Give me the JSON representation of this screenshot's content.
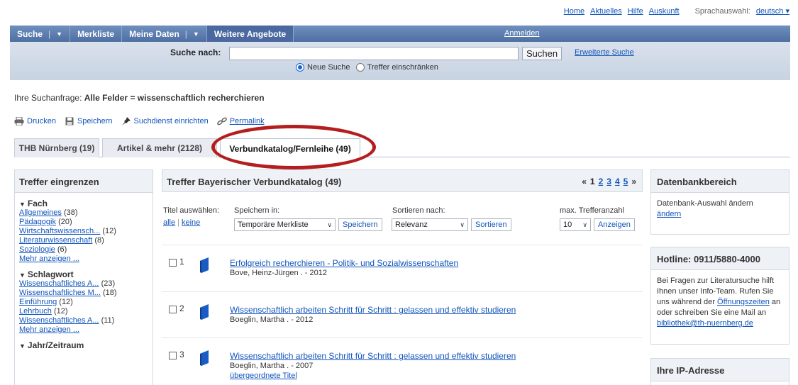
{
  "top_links": {
    "home": "Home",
    "news": "Aktuelles",
    "help": "Hilfe",
    "info": "Auskunft",
    "lang_label": "Sprachauswahl:",
    "lang_value": "deutsch"
  },
  "nav": {
    "search": "Suche",
    "list": "Merkliste",
    "mydata": "Meine Daten",
    "more": "Weitere Angebote",
    "login": "Anmelden"
  },
  "search": {
    "label": "Suche nach:",
    "value": "",
    "button": "Suchen",
    "advanced": "Erweiterte Suche",
    "radio_new": "Neue Suche",
    "radio_restrict": "Treffer einschränken"
  },
  "query": {
    "prefix": "Ihre Suchanfrage:",
    "text": "Alle Felder = wissenschaftlich recherchieren"
  },
  "toolbar": {
    "print": "Drucken",
    "save": "Speichern",
    "alert": "Suchdienst einrichten",
    "permalink": "Permalink"
  },
  "tabs": [
    "THB Nürnberg (19)",
    "Artikel & mehr (2128)",
    "Verbundkatalog/Fernleihe (49)"
  ],
  "left": {
    "title": "Treffer eingrenzen",
    "facets": [
      {
        "title": "Fach",
        "items": [
          {
            "label": "Allgemeines",
            "count": "(38)"
          },
          {
            "label": "Pädagogik",
            "count": "(20)"
          },
          {
            "label": "Wirtschaftswissensch...",
            "count": "(12)"
          },
          {
            "label": "Literaturwissenschaft",
            "count": "(8)"
          },
          {
            "label": "Soziologie",
            "count": "(6)"
          }
        ],
        "more": "Mehr anzeigen ..."
      },
      {
        "title": "Schlagwort",
        "items": [
          {
            "label": "Wissenschaftliches A...",
            "count": "(23)"
          },
          {
            "label": "Wissenschaftliches M...",
            "count": "(18)"
          },
          {
            "label": "Einführung",
            "count": "(12)"
          },
          {
            "label": "Lehrbuch",
            "count": "(12)"
          },
          {
            "label": "Wissenschaftliches A...",
            "count": "(11)"
          }
        ],
        "more": "Mehr anzeigen ..."
      },
      {
        "title": "Jahr/Zeitraum",
        "items": [],
        "more": ""
      }
    ]
  },
  "center": {
    "title": "Treffer Bayerischer Verbundkatalog (49)",
    "pager": {
      "prev": "«",
      "pages": [
        "1",
        "2",
        "3",
        "4",
        "5"
      ],
      "next": "»"
    },
    "select_label": "Titel auswählen:",
    "select_all": "alle",
    "select_none": "keine",
    "save_label": "Speichern in:",
    "save_target": "Temporäre Merkliste",
    "save_btn": "Speichern",
    "sort_label": "Sortieren nach:",
    "sort_value": "Relevanz",
    "sort_btn": "Sortieren",
    "max_label": "max. Trefferanzahl",
    "max_value": "10",
    "max_btn": "Anzeigen",
    "results": [
      {
        "num": "1",
        "title": "Erfolgreich recherchieren - Politik- und Sozialwissenschaften",
        "author": "Bove, Heinz-Jürgen . - 2012",
        "parent": ""
      },
      {
        "num": "2",
        "title": "Wissenschaftlich arbeiten Schritt für Schritt : gelassen und effektiv studieren",
        "author": "Boeglin, Martha . - 2012",
        "parent": ""
      },
      {
        "num": "3",
        "title": "Wissenschaftlich arbeiten Schritt für Schritt : gelassen und effektiv studieren",
        "author": "Boeglin, Martha . - 2007",
        "parent": "übergeordnete Titel"
      }
    ]
  },
  "right": {
    "db": {
      "title": "Datenbankbereich",
      "text": "Datenbank-Auswahl ändern",
      "link": "ändern"
    },
    "hotline": {
      "title": "Hotline: 0911/5880-4000",
      "text1": "Bei Fragen zur Literatursuche hilft Ihnen unser Info-Team. Rufen Sie uns während der",
      "link1": "Öffnungszeiten",
      "text2": "an oder schreiben Sie eine Mail an",
      "link2": "bibliothek@th-nuernberg.de"
    },
    "ip": {
      "title": "Ihre IP-Adresse"
    }
  },
  "colors": {
    "nav": "#5a79ab",
    "link": "#1155bb",
    "highlight_ring": "#b51e1e"
  }
}
